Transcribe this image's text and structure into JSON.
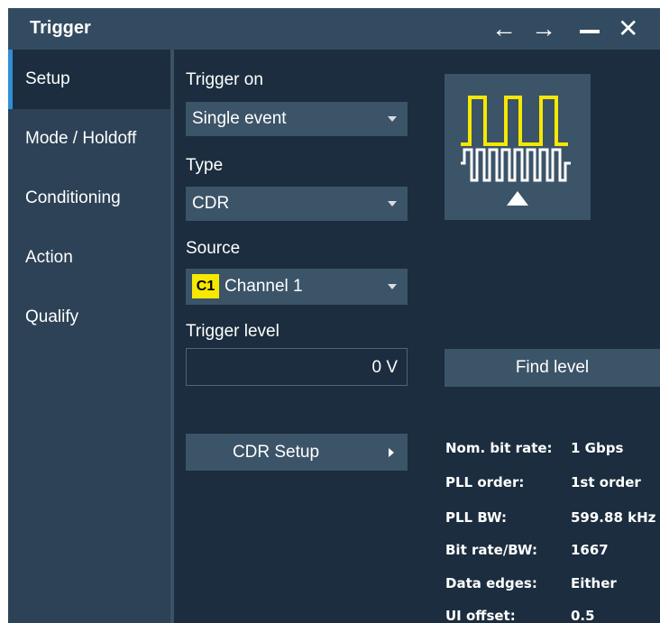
{
  "window": {
    "title": "Trigger",
    "icons": [
      "left-arrow-icon",
      "right-arrow-icon",
      "minimize-icon",
      "close-icon"
    ]
  },
  "sidebar": {
    "items": [
      {
        "label": "Setup",
        "active": true
      },
      {
        "label": "Mode / Holdoff"
      },
      {
        "label": "Conditioning"
      },
      {
        "label": "Action"
      },
      {
        "label": "Qualify"
      }
    ]
  },
  "setup": {
    "trigger_on": {
      "label": "Trigger on",
      "value": "Single event"
    },
    "type": {
      "label": "Type",
      "value": "CDR"
    },
    "source": {
      "label": "Source",
      "badge": "C1",
      "value": "Channel 1"
    },
    "trigger_level": {
      "label": "Trigger level",
      "value": "0 V"
    },
    "find_level_label": "Find level",
    "cdr_setup_label": "CDR Setup",
    "cdr_info": [
      {
        "key": "Nom. bit rate:",
        "value": "1 Gbps"
      },
      {
        "key": "PLL order:",
        "value": "1st order"
      },
      {
        "key": "PLL BW:",
        "value": "599.88 kHz"
      },
      {
        "key": "Bit rate/BW:",
        "value": "1667"
      },
      {
        "key": "Data edges:",
        "value": "Either"
      },
      {
        "key": "UI offset:",
        "value": "0.5"
      }
    ]
  },
  "colors": {
    "panel_bg": "#1b2d3e",
    "titlebar_bg": "#334b60",
    "sidebar_bg": "#2d4256",
    "accent": "#2f8ed6",
    "channel1": "#f6e800"
  }
}
